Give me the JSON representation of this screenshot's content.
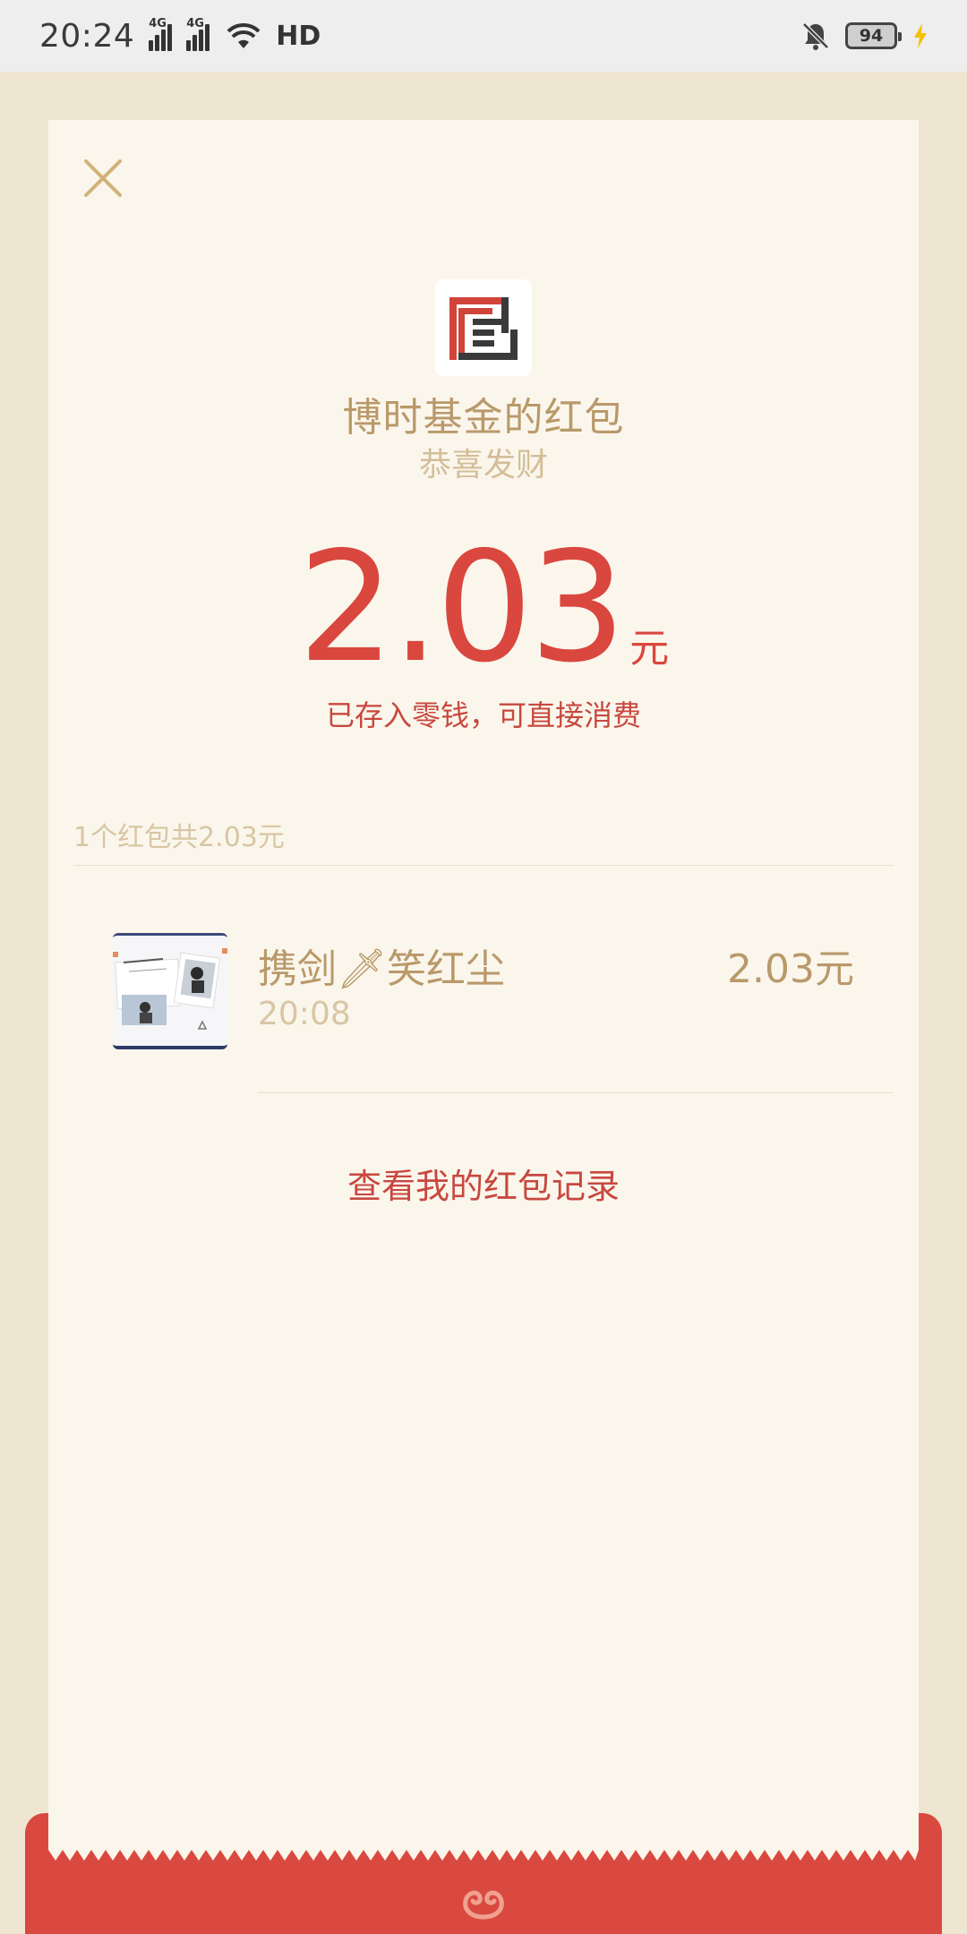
{
  "status_bar": {
    "time": "20:24",
    "network_1": "4G",
    "network_2": "4G",
    "hd_label": "HD",
    "battery_level": "94",
    "icons": [
      "signal-icon",
      "wifi-icon",
      "mute-bell-icon",
      "battery-icon",
      "charging-icon"
    ]
  },
  "red_packet": {
    "sender_name": "博时基金的红包",
    "greeting": "恭喜发财",
    "amount": "2.03",
    "amount_unit": "元",
    "deposit_note": "已存入零钱，可直接消费",
    "summary": "1个红包共2.03元",
    "receivers": [
      {
        "name": "携剑🗡笑红尘",
        "time": "20:08",
        "amount": "2.03元"
      }
    ],
    "history_link": "查看我的红包记录"
  },
  "colors": {
    "accent_red": "#D9473F",
    "gold": "#B9996A",
    "card_bg": "#FBF6EC",
    "page_bg": "#EFE6D2"
  }
}
